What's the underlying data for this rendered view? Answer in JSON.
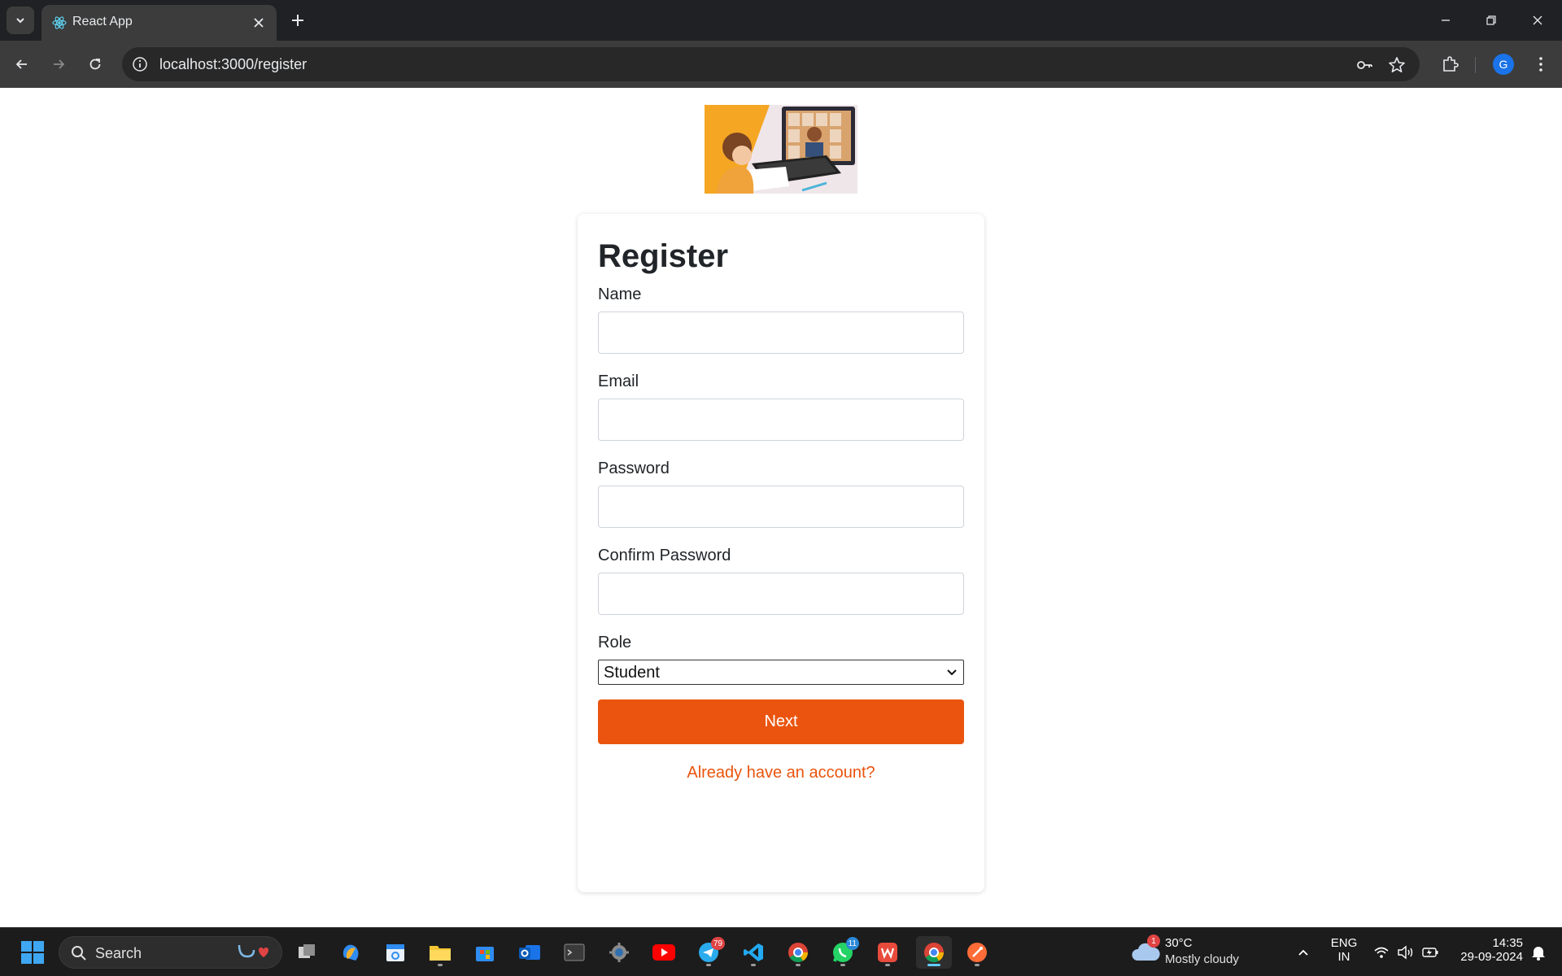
{
  "browser": {
    "tab_title": "React App",
    "url": "localhost:3000/register",
    "profile_initial": "G"
  },
  "form": {
    "title": "Register",
    "fields": [
      {
        "label": "Name",
        "value": ""
      },
      {
        "label": "Email",
        "value": ""
      },
      {
        "label": "Password",
        "value": ""
      },
      {
        "label": "Confirm Password",
        "value": ""
      }
    ],
    "role_label": "Role",
    "role_selected": "Student",
    "submit_label": "Next",
    "signin_link": "Already have an account?"
  },
  "colors": {
    "accent": "#ea540e",
    "chrome_dark": "#202124",
    "chrome_toolbar": "#3c3c3c"
  },
  "taskbar": {
    "search_placeholder": "Search",
    "badges": {
      "telegram": "79",
      "whatsapp": "11",
      "weather": "1"
    },
    "weather_temp": "30°C",
    "weather_desc": "Mostly cloudy",
    "lang_line1": "ENG",
    "lang_line2": "IN",
    "time": "14:35",
    "date": "29-09-2024"
  }
}
